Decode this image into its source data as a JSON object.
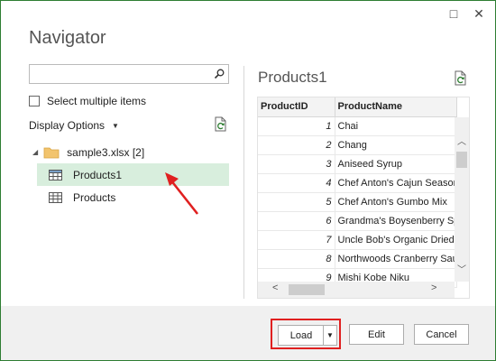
{
  "window": {
    "title": "Navigator",
    "minimize_icon": "□",
    "close_icon": "✕"
  },
  "left_pane": {
    "search": {
      "value": "",
      "placeholder": ""
    },
    "select_multiple_label": "Select multiple items",
    "select_multiple_checked": false,
    "display_options_label": "Display Options",
    "tree": {
      "root_label": "sample3.xlsx [2]",
      "items": [
        {
          "label": "Products1",
          "selected": true
        },
        {
          "label": "Products",
          "selected": false
        }
      ]
    }
  },
  "preview": {
    "title": "Products1",
    "columns": [
      "ProductID",
      "ProductName"
    ],
    "rows": [
      {
        "id": "1",
        "name": "Chai"
      },
      {
        "id": "2",
        "name": "Chang"
      },
      {
        "id": "3",
        "name": "Aniseed Syrup"
      },
      {
        "id": "4",
        "name": "Chef Anton's Cajun Season"
      },
      {
        "id": "5",
        "name": "Chef Anton's Gumbo Mix"
      },
      {
        "id": "6",
        "name": "Grandma's Boysenberry Sp"
      },
      {
        "id": "7",
        "name": "Uncle Bob's Organic Dried"
      },
      {
        "id": "8",
        "name": "Northwoods Cranberry Sau"
      },
      {
        "id": "9",
        "name": "Mishi Kobe Niku"
      }
    ]
  },
  "footer": {
    "load_label": "Load",
    "edit_label": "Edit",
    "cancel_label": "Cancel"
  },
  "colors": {
    "window_border": "#2e7d32",
    "selection": "#d8eedd",
    "highlight": "#e02020",
    "footer_bg": "#f0f0f0"
  }
}
